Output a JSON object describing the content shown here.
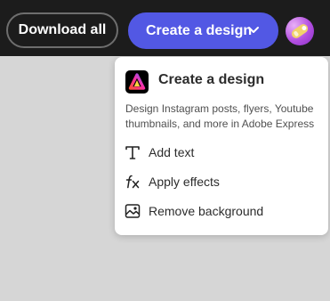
{
  "toolbar": {
    "download_all_label": "Download all",
    "create_design_label": "Create a design"
  },
  "menu": {
    "title": "Create a design",
    "description": "Design Instagram posts, flyers, Youtube thumbnails, and more in Adobe Express",
    "items": [
      {
        "label": "Add text",
        "icon": "text-icon"
      },
      {
        "label": "Apply effects",
        "icon": "fx-icon"
      },
      {
        "label": "Remove background",
        "icon": "remove-background-icon"
      }
    ]
  },
  "colors": {
    "topbar": "#1c1c1c",
    "primary_button": "#5258e4",
    "canvas": "#d6d6d6"
  }
}
